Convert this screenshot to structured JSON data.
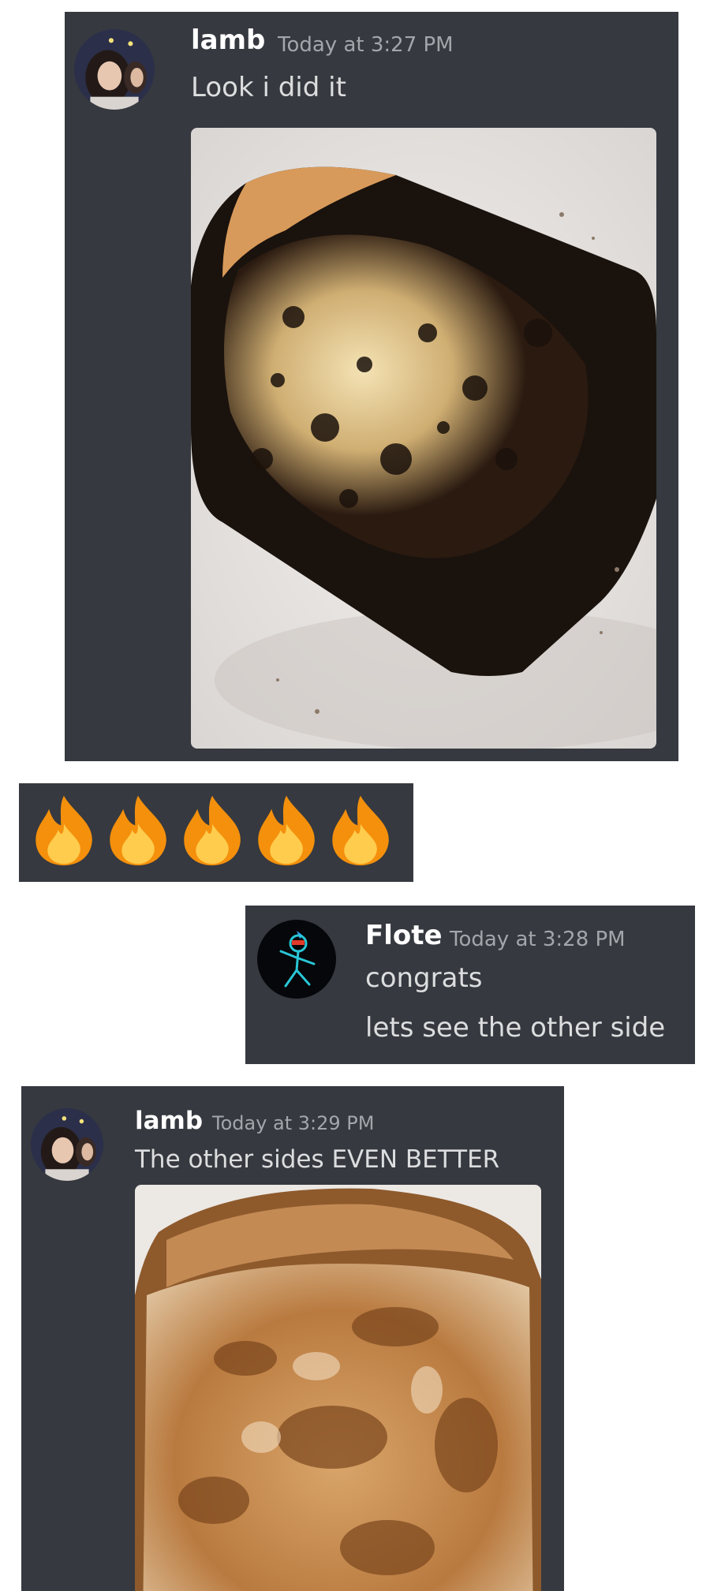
{
  "messages": [
    {
      "username": "lamb",
      "timestamp": "Today at 3:27 PM",
      "lines": [
        "Look i did it"
      ],
      "avatar": "girl-photo-avatar",
      "attachment": "burnt-toast-photo"
    },
    {
      "reaction_emoji": [
        "🔥",
        "🔥",
        "🔥",
        "🔥",
        "🔥"
      ],
      "emoji_icon": "fire-emoji-icon"
    },
    {
      "username": "Flote",
      "timestamp": "Today at 3:28 PM",
      "lines": [
        "congrats",
        "lets see the other side"
      ],
      "avatar": "stick-figure-avatar"
    },
    {
      "username": "lamb",
      "timestamp": "Today at 3:29 PM",
      "lines": [
        "The other sides EVEN BETTER"
      ],
      "avatar": "girl-photo-avatar",
      "attachment": "toasted-bread-photo"
    }
  ],
  "colors": {
    "panel_bg": "#36393f",
    "username": "#ffffff",
    "timestamp": "#a3a6aa",
    "message_text": "#dcddde",
    "page_bg": "#ffffff"
  }
}
